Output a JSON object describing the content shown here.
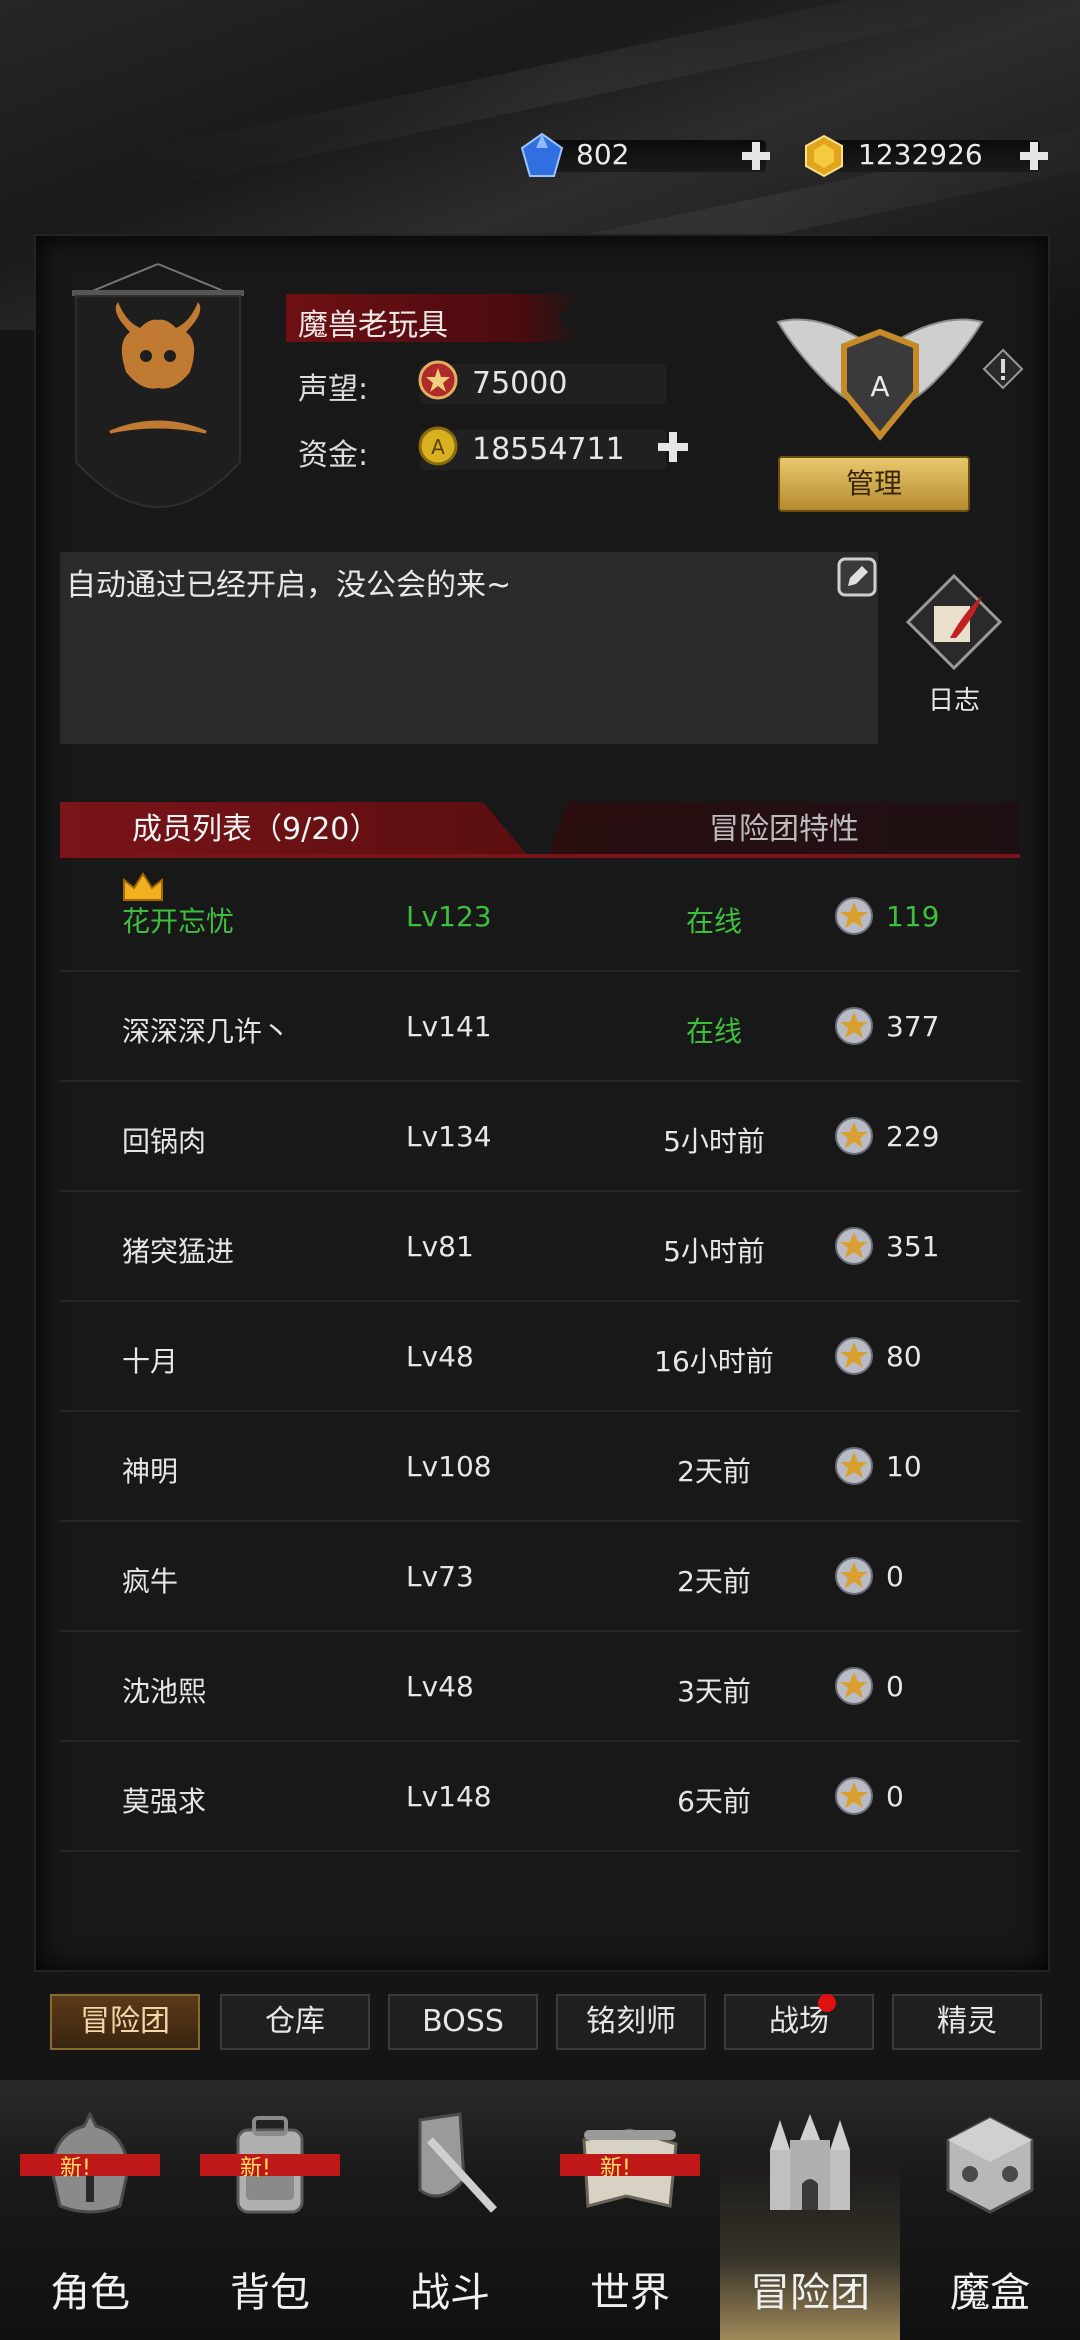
{
  "currency": {
    "gems": "802",
    "gold": "1232926"
  },
  "guild": {
    "name": "魔兽老玩具",
    "reputation_label": "声望:",
    "reputation": "75000",
    "funds_label": "资金:",
    "funds": "18554711",
    "rank_letter": "A",
    "manage_label": "管理",
    "notice": "自动通过已经开启，没公会的来~",
    "log_label": "日志"
  },
  "tabs": {
    "members": "成员列表（9/20）",
    "traits": "冒险团特性"
  },
  "members": [
    {
      "name": "花开忘忧",
      "level": "Lv123",
      "status": "在线",
      "contribution": "119",
      "leader": true,
      "online": true
    },
    {
      "name": "深深深几许丶",
      "level": "Lv141",
      "status": "在线",
      "contribution": "377",
      "online": true
    },
    {
      "name": "回锅肉",
      "level": "Lv134",
      "status": "5小时前",
      "contribution": "229"
    },
    {
      "name": "猪突猛进",
      "level": "Lv81",
      "status": "5小时前",
      "contribution": "351"
    },
    {
      "name": "十月",
      "level": "Lv48",
      "status": "16小时前",
      "contribution": "80"
    },
    {
      "name": "神明",
      "level": "Lv108",
      "status": "2天前",
      "contribution": "10"
    },
    {
      "name": "疯牛",
      "level": "Lv73",
      "status": "2天前",
      "contribution": "0"
    },
    {
      "name": "沈池熙",
      "level": "Lv48",
      "status": "3天前",
      "contribution": "0"
    },
    {
      "name": "莫强求",
      "level": "Lv148",
      "status": "6天前",
      "contribution": "0"
    }
  ],
  "subtabs": [
    "冒险团",
    "仓库",
    "BOSS",
    "铭刻师",
    "战场",
    "精灵"
  ],
  "nav": [
    {
      "label": "角色",
      "new": true,
      "badge": "新!"
    },
    {
      "label": "背包",
      "new": true,
      "badge": "新!"
    },
    {
      "label": "战斗"
    },
    {
      "label": "世界",
      "new": true,
      "badge": "新!"
    },
    {
      "label": "冒险团",
      "active": true
    },
    {
      "label": "魔盒"
    }
  ],
  "colors": {
    "accent_red": "#7a1418",
    "online_green": "#3dbf3d",
    "gold": "#e8c86e"
  }
}
